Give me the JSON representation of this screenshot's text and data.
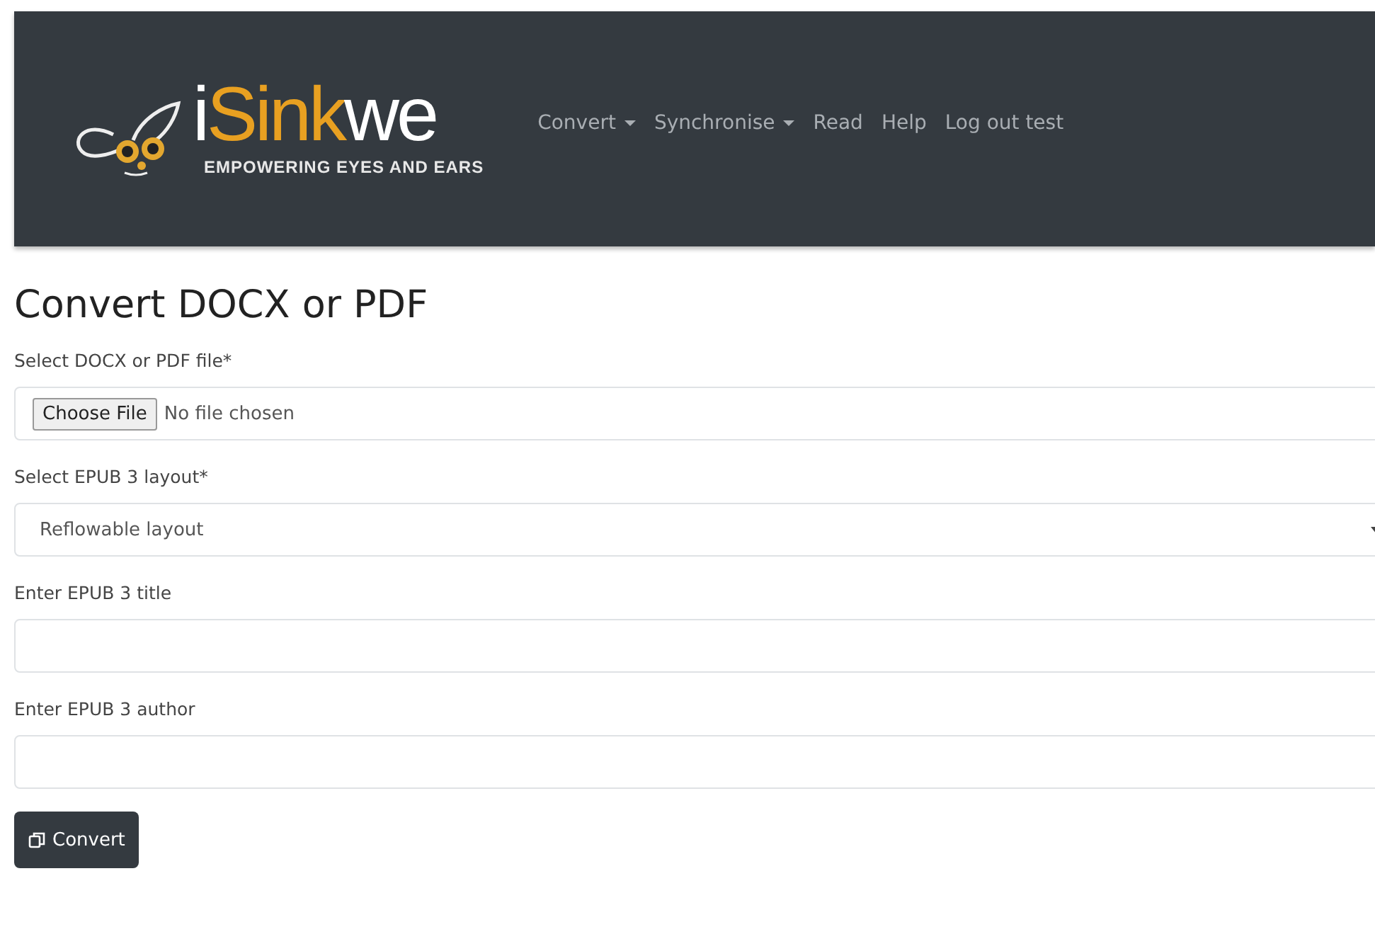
{
  "navbar": {
    "logo": {
      "parts": [
        {
          "text": "i",
          "kind": "white"
        },
        {
          "text": "Sink",
          "kind": "orange"
        },
        {
          "text": "we",
          "kind": "white"
        }
      ],
      "tagline": "EMPOWERING EYES AND EARS"
    },
    "items": [
      {
        "label": "Convert",
        "kind": "dropdown"
      },
      {
        "label": "Synchronise",
        "kind": "dropdown"
      },
      {
        "label": "Read",
        "kind": "link"
      },
      {
        "label": "Help",
        "kind": "link"
      },
      {
        "label": "Log out test",
        "kind": "link"
      }
    ]
  },
  "heading": "Convert DOCX or PDF",
  "fields": [
    {
      "label": "Select DOCX or PDF file*",
      "kind": "file",
      "button": "Choose File",
      "value": "No file chosen"
    },
    {
      "label": "Select EPUB 3 layout*",
      "kind": "select",
      "value": "Reflowable layout"
    },
    {
      "label": "Enter EPUB 3 title",
      "kind": "text"
    },
    {
      "label": "Enter EPUB 3 author",
      "kind": "text"
    }
  ],
  "submit": "Convert"
}
